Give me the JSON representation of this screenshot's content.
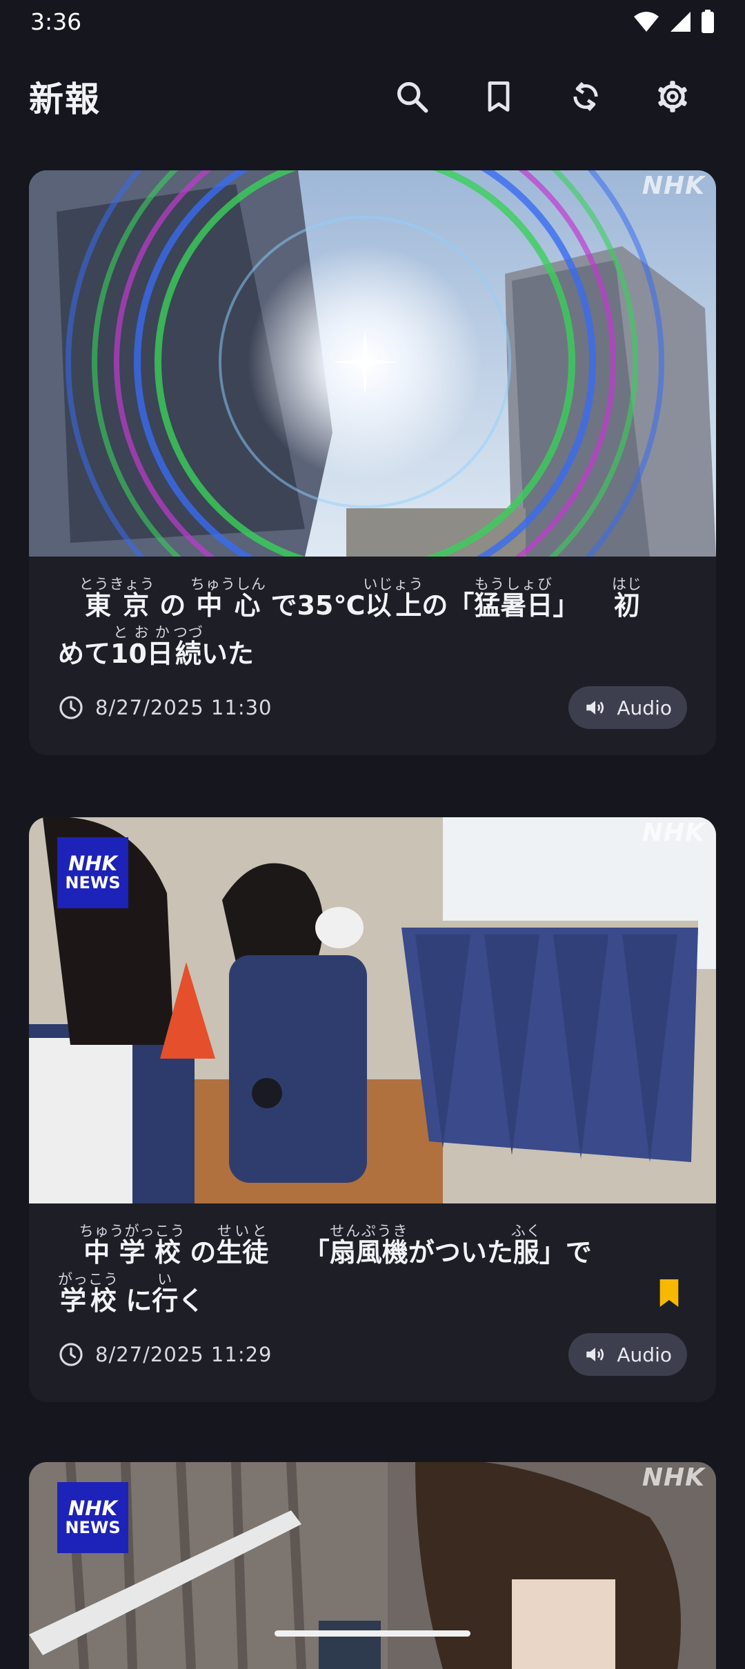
{
  "status_bar": {
    "time": "3:36"
  },
  "app_bar": {
    "title": "新報",
    "actions": [
      "search-icon",
      "bookmark-icon",
      "refresh-icon",
      "settings-icon"
    ]
  },
  "colors": {
    "bookmark_accent": "#f6b800",
    "audio_pill": "#3d3f4f",
    "badge_blue": "#1d22b8"
  },
  "watermark": "NHK",
  "badge": {
    "line1": "NHK",
    "line2": "NEWS"
  },
  "articles": [
    {
      "headline": [
        {
          "t": "東京",
          "r": "とうきょう"
        },
        {
          "t": "の"
        },
        {
          "t": "中心",
          "r": "ちゅうしん"
        },
        {
          "t": "で35℃"
        },
        {
          "t": "以上",
          "r": "いじょう"
        },
        {
          "t": "の「"
        },
        {
          "t": "猛暑日",
          "r": "もうしょび"
        },
        {
          "t": "」"
        },
        {
          "t": "初",
          "r": "はじ"
        },
        {
          "t": "めて"
        },
        {
          "t": "10日",
          "r": "とおか"
        },
        {
          "t": "続",
          "r": "つづ"
        },
        {
          "t": "いた"
        }
      ],
      "timestamp": "8/27/2025 11:30",
      "audio_label": "Audio",
      "bookmarked": false
    },
    {
      "headline": [
        {
          "t": "中学校",
          "r": "ちゅうがっこう"
        },
        {
          "t": "の"
        },
        {
          "t": "生徒",
          "r": "せいと"
        },
        {
          "t": "「"
        },
        {
          "t": "扇風機",
          "r": "せんぷうき"
        },
        {
          "t": "がついた"
        },
        {
          "t": "服",
          "r": "ふく"
        },
        {
          "t": "」で"
        },
        {
          "t": "学校",
          "r": "がっこう"
        },
        {
          "t": "に"
        },
        {
          "t": "行",
          "r": "い"
        },
        {
          "t": "く"
        }
      ],
      "timestamp": "8/27/2025 11:29",
      "audio_label": "Audio",
      "bookmarked": true
    }
  ]
}
